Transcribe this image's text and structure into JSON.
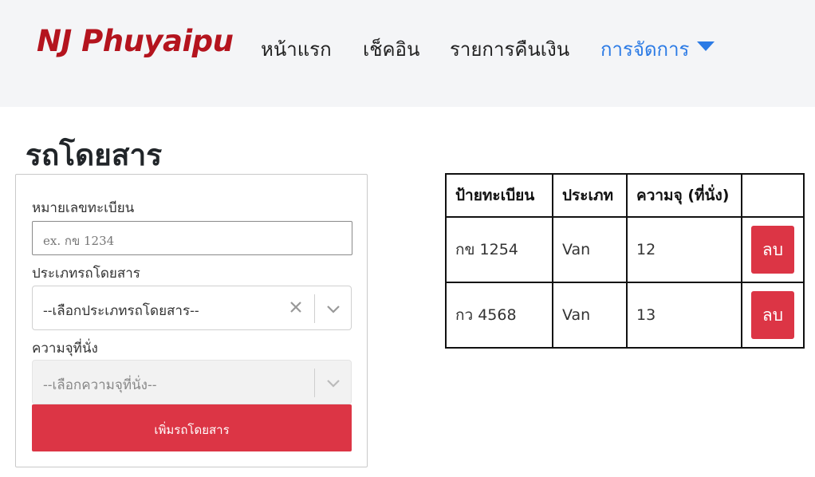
{
  "nav": {
    "brand": "NJ Phuyaipu",
    "items": [
      {
        "label": "หน้าแรก"
      },
      {
        "label": "เช็คอิน"
      },
      {
        "label": "รายการคืนเงิน"
      },
      {
        "label": "การจัดการ"
      }
    ],
    "active_color": "#2c7be5",
    "brand_color": "#b4141e"
  },
  "page": {
    "title": "รถโดยสาร"
  },
  "form": {
    "plate_label": "หมายเลขทะเบียน",
    "plate_placeholder": "ex. กข 1234",
    "type_label": "ประเภทรถโดยสาร",
    "type_value": "--เลือกประเภทรถโดยสาร--",
    "capacity_label": "ความจุที่นั่ง",
    "capacity_value": "--เลือกความจุที่นั่ง--",
    "submit_label": "เพิ่มรถโดยสาร",
    "button_color": "#dc3545"
  },
  "table": {
    "headers": [
      "ป้ายทะเบียน",
      "ประเภท",
      "ความจุ (ที่นั่ง)",
      ""
    ],
    "rows": [
      {
        "plate": "กข 1254",
        "type": "Van",
        "capacity": "12",
        "action": "ลบ"
      },
      {
        "plate": "กว 4568",
        "type": "Van",
        "capacity": "13",
        "action": "ลบ"
      }
    ]
  }
}
